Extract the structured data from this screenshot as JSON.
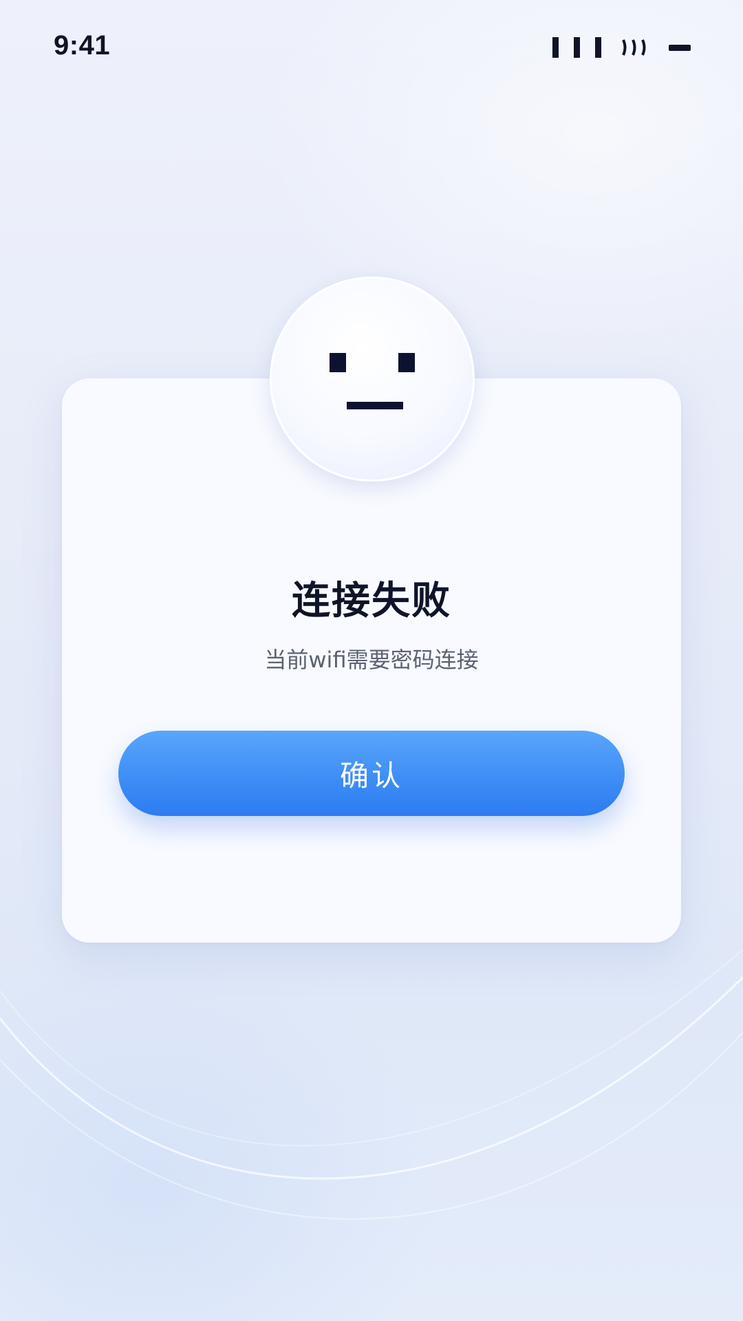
{
  "status_bar": {
    "time": "9:41",
    "icons": [
      "signal-icon",
      "wifi-icon",
      "battery-icon"
    ]
  },
  "dialog": {
    "illustration": "neutral-face-icon",
    "title": "连接失败",
    "message": "当前wifi需要密码连接",
    "confirm_label": "确认"
  },
  "colors": {
    "accent": "#3e8ef6",
    "title_text": "#10142a",
    "body_text": "#5b6272",
    "background": "#e6ebf8",
    "card": "#f8faff"
  }
}
